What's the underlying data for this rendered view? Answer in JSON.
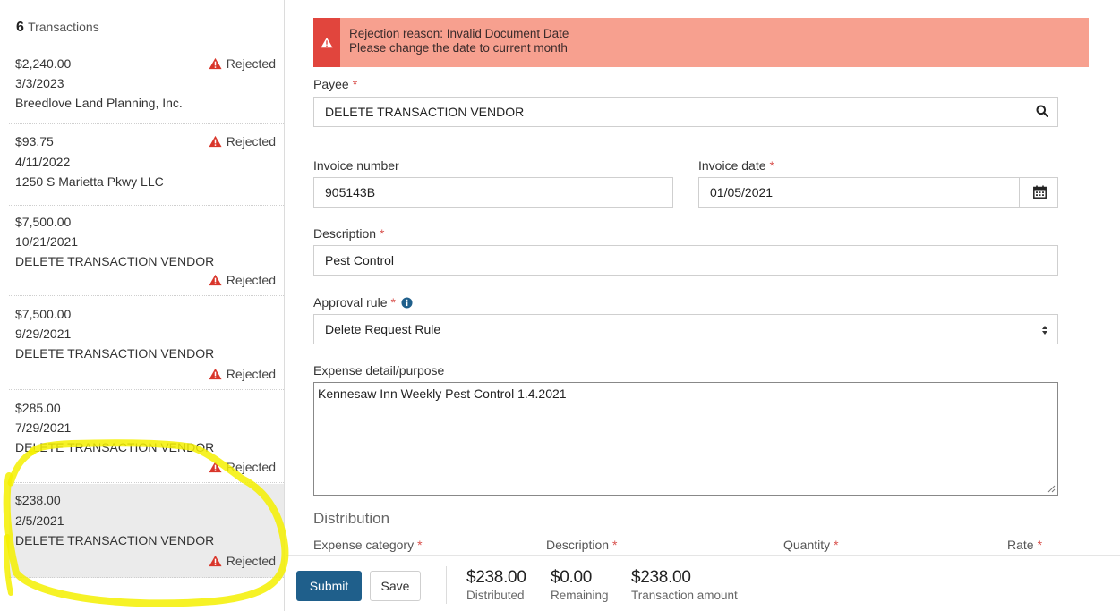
{
  "sidebar": {
    "count_number": "6",
    "count_label": "Transactions",
    "items": [
      {
        "amount": "$2,240.00",
        "date": "3/3/2023",
        "vendor": "Breedlove Land Planning, Inc.",
        "status": "Rejected"
      },
      {
        "amount": "$93.75",
        "date": "4/11/2022",
        "vendor": "1250 S Marietta Pkwy LLC",
        "status": "Rejected"
      },
      {
        "amount": "$7,500.00",
        "date": "10/21/2021",
        "vendor": "DELETE TRANSACTION VENDOR",
        "status": "Rejected"
      },
      {
        "amount": "$7,500.00",
        "date": "9/29/2021",
        "vendor": "DELETE TRANSACTION VENDOR",
        "status": "Rejected"
      },
      {
        "amount": "$285.00",
        "date": "7/29/2021",
        "vendor": "DELETE TRANSACTION VENDOR",
        "status": "Rejected"
      },
      {
        "amount": "$238.00",
        "date": "2/5/2021",
        "vendor": "DELETE TRANSACTION VENDOR",
        "status": "Rejected"
      }
    ]
  },
  "alert": {
    "line1": "Rejection reason: Invalid Document Date",
    "line2": "Please change the date to current month"
  },
  "form": {
    "payee_label": "Payee",
    "payee_value": "DELETE TRANSACTION VENDOR",
    "invoice_number_label": "Invoice number",
    "invoice_number_value": "905143B",
    "invoice_date_label": "Invoice date",
    "invoice_date_value": "01/05/2021",
    "description_label": "Description",
    "description_value": "Pest Control",
    "approval_rule_label": "Approval rule",
    "approval_rule_value": "Delete Request Rule",
    "expense_detail_label": "Expense detail/purpose",
    "expense_detail_value": "Kennesaw Inn Weekly Pest Control 1.4.2021",
    "required_mark": "*"
  },
  "distribution": {
    "title": "Distribution",
    "columns": [
      "Expense category",
      "Description",
      "Quantity",
      "Rate"
    ]
  },
  "footer": {
    "submit_label": "Submit",
    "save_label": "Save",
    "distributed_amount": "$238.00",
    "distributed_label": "Distributed",
    "remaining_amount": "$0.00",
    "remaining_label": "Remaining",
    "transaction_amount": "$238.00",
    "transaction_label": "Transaction amount"
  },
  "colors": {
    "alert_bg": "#f7a08f",
    "alert_icon_bg": "#e1453d",
    "warning_icon": "#d9362b",
    "submit_bg": "#1f5f8b",
    "required": "#d9534f",
    "highlight_annotation": "#f5f000"
  },
  "icons": {
    "status": "warning-triangle-icon",
    "payee_search": "search-icon",
    "calendar": "calendar-icon",
    "info": "info-circle-icon",
    "select": "select-arrows-icon"
  }
}
